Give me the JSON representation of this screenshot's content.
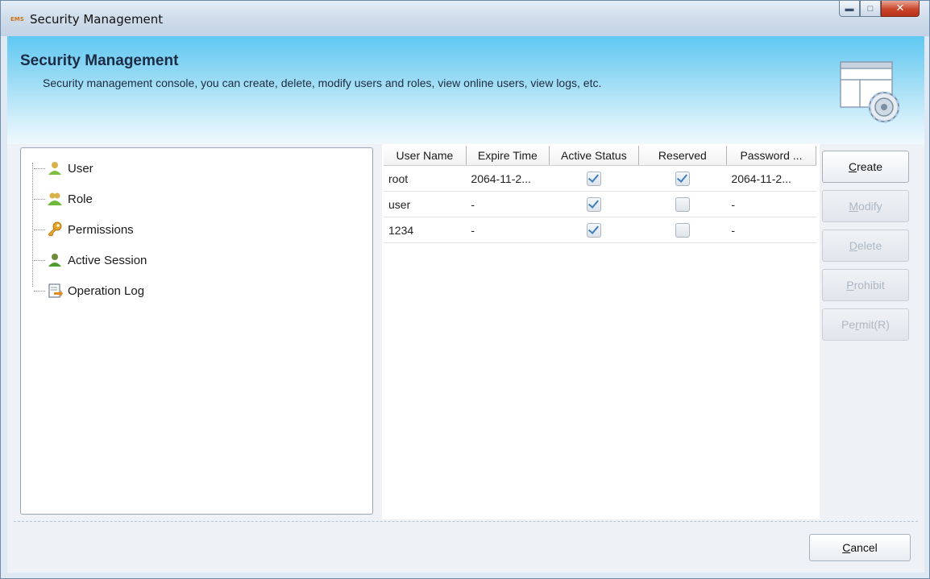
{
  "window": {
    "title": "Security Management",
    "app_icon_text": "EMS",
    "controls": [
      "minimize-icon",
      "maximize-icon",
      "close-icon"
    ]
  },
  "banner": {
    "title": "Security Management",
    "description": "Security management console, you can create, delete, modify users and roles, view online users, view logs, etc.",
    "icon": "security-console-icon"
  },
  "tree": {
    "items": [
      {
        "label": "User",
        "icon": "user-icon"
      },
      {
        "label": "Role",
        "icon": "role-icon"
      },
      {
        "label": "Permissions",
        "icon": "key-icon"
      },
      {
        "label": "Active Session",
        "icon": "session-user-icon"
      },
      {
        "label": "Operation Log",
        "icon": "operation-log-icon"
      }
    ]
  },
  "table": {
    "columns": [
      "User Name",
      "Expire Time",
      "Active Status",
      "Reserved",
      "Password ..."
    ],
    "rows": [
      {
        "user_name": "root",
        "expire_time": "2064-11-2...",
        "active": true,
        "reserved": true,
        "password_expire": "2064-11-2..."
      },
      {
        "user_name": "user",
        "expire_time": "-",
        "active": true,
        "reserved": false,
        "password_expire": "-"
      },
      {
        "user_name": "1234",
        "expire_time": "-",
        "active": true,
        "reserved": false,
        "password_expire": "-"
      }
    ]
  },
  "actions": {
    "create": {
      "prefix": "",
      "mnemonic": "C",
      "rest": "reate",
      "enabled": true
    },
    "modify": {
      "prefix": "",
      "mnemonic": "M",
      "rest": "odify",
      "enabled": false
    },
    "delete": {
      "prefix": "",
      "mnemonic": "D",
      "rest": "elete",
      "enabled": false
    },
    "prohibit": {
      "prefix": "",
      "mnemonic": "P",
      "rest": "rohibit",
      "enabled": false
    },
    "permit": {
      "prefix": "Pe",
      "mnemonic": "r",
      "rest": "mit(R)",
      "enabled": false
    }
  },
  "footer": {
    "cancel": {
      "mnemonic": "C",
      "rest": "ancel"
    }
  },
  "colors": {
    "banner_top": "#5fc8f2",
    "disabled_text": "#aeb8c4",
    "check_mark": "#3e7fbf"
  }
}
